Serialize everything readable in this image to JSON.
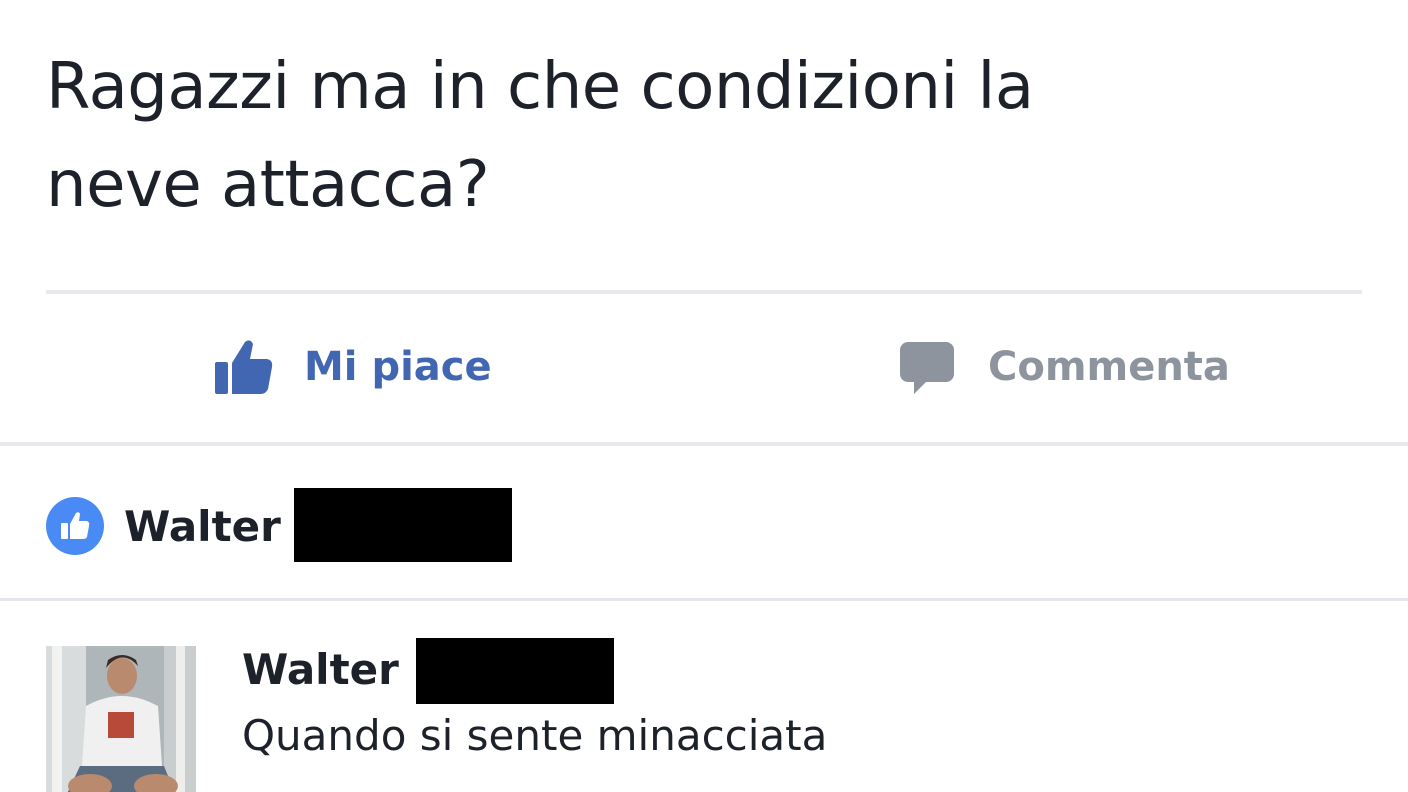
{
  "post": {
    "text_line1": "Ragazzi ma in che condizioni la",
    "text_line2": "neve attacca?"
  },
  "actions": {
    "like_label": "Mi piace",
    "comment_label": "Commenta",
    "like_icon": "thumbs-up-icon",
    "comment_icon": "speech-bubble-icon"
  },
  "likes": {
    "name": "Walter",
    "icon": "like-badge-icon"
  },
  "comment": {
    "author": "Walter",
    "text": "Quando si sente minacciata"
  },
  "colors": {
    "like_blue": "#4267b2",
    "badge_blue": "#4a8af4",
    "muted_gray": "#8d949e",
    "text": "#1d2129"
  }
}
